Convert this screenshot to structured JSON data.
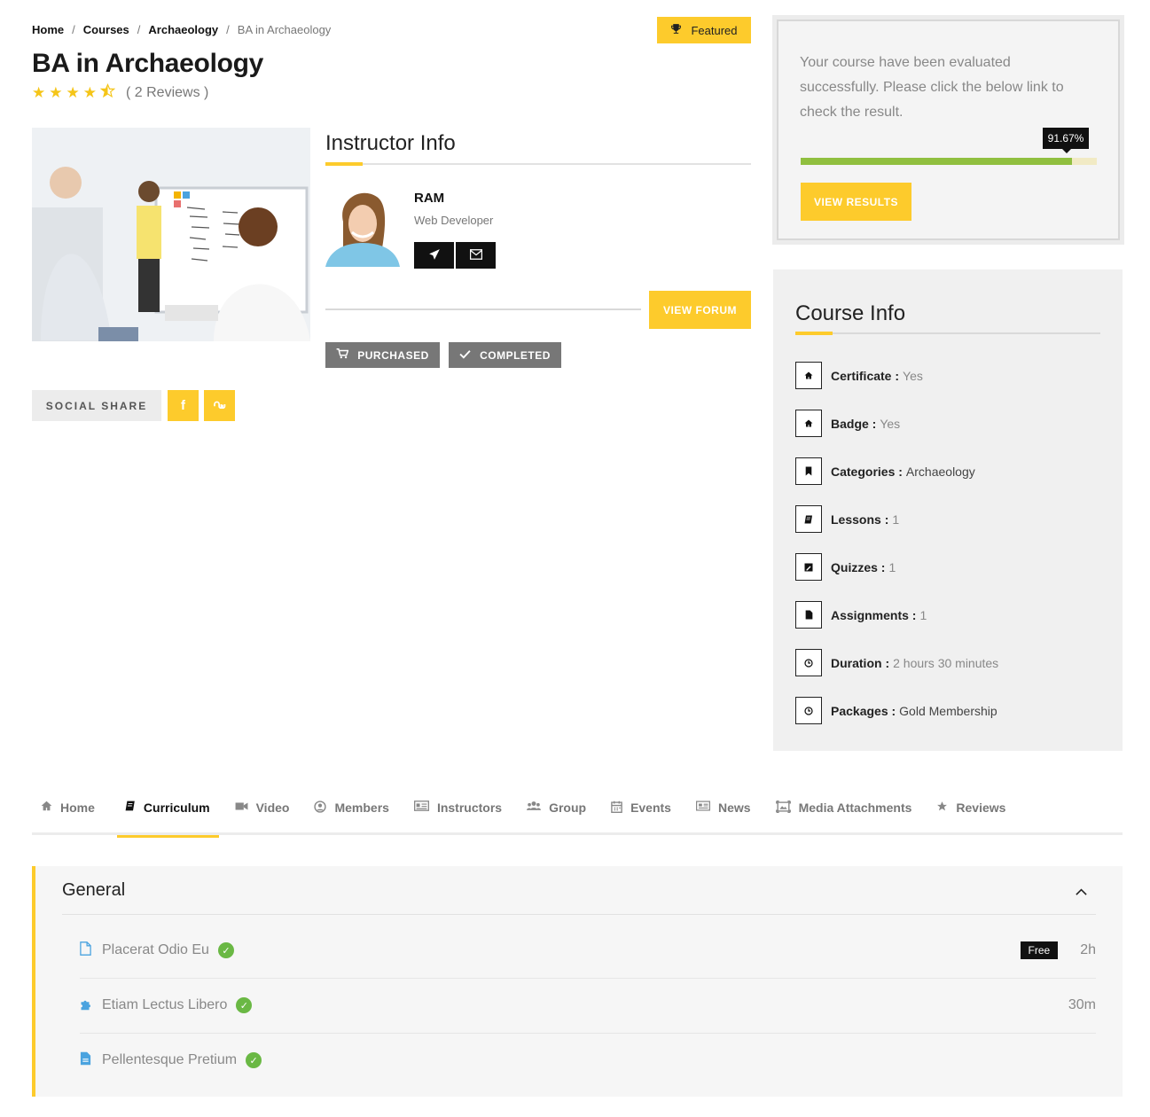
{
  "breadcrumb": {
    "items": [
      "Home",
      "Courses",
      "Archaeology"
    ],
    "current": "BA in Archaeology",
    "separator": "/"
  },
  "course": {
    "title": "BA in Archaeology",
    "rating": 4.5,
    "reviews_text": "( 2 Reviews )",
    "featured_label": "Featured"
  },
  "instructor": {
    "heading": "Instructor Info",
    "name": "RAM",
    "role": "Web Developer",
    "forum_button": "VIEW FORUM",
    "purchased_label": "PURCHASED",
    "completed_label": "COMPLETED"
  },
  "social": {
    "label": "SOCIAL SHARE",
    "facebook": "f"
  },
  "evaluation": {
    "message": "Your course have been evaluated successfully. Please click the below link to check the result.",
    "progress_text": "91.67%",
    "progress_value": 91.67,
    "button": "VIEW RESULTS"
  },
  "course_info": {
    "heading": "Course Info",
    "items": [
      {
        "label": "Certificate :",
        "value": "Yes",
        "icon": "home-icon"
      },
      {
        "label": "Badge :",
        "value": "Yes",
        "icon": "home-icon"
      },
      {
        "label": "Categories :",
        "value": "Archaeology",
        "icon": "bookmark-icon"
      },
      {
        "label": "Lessons :",
        "value": "1",
        "icon": "book-icon"
      },
      {
        "label": "Quizzes :",
        "value": "1",
        "icon": "quiz-icon"
      },
      {
        "label": "Assignments :",
        "value": "1",
        "icon": "file-icon"
      },
      {
        "label": "Duration :",
        "value": "2 hours 30 minutes",
        "icon": "clock-icon"
      },
      {
        "label": "Packages :",
        "value": "Gold Membership",
        "icon": "clock-icon"
      }
    ]
  },
  "tabs": [
    {
      "label": "Home",
      "icon": "home-icon"
    },
    {
      "label": "Curriculum",
      "icon": "book-icon"
    },
    {
      "label": "Video",
      "icon": "video-icon"
    },
    {
      "label": "Members",
      "icon": "user-icon"
    },
    {
      "label": "Instructors",
      "icon": "id-card-icon"
    },
    {
      "label": "Group",
      "icon": "users-icon"
    },
    {
      "label": "Events",
      "icon": "calendar-icon"
    },
    {
      "label": "News",
      "icon": "newspaper-icon"
    },
    {
      "label": "Media Attachments",
      "icon": "image-icon"
    },
    {
      "label": "Reviews",
      "icon": "star-icon"
    }
  ],
  "curriculum": {
    "section_title": "General",
    "lessons": [
      {
        "title": "Placerat Odio Eu",
        "badge": "Free",
        "duration": "2h",
        "icon": "document-icon"
      },
      {
        "title": "Etiam Lectus Libero",
        "badge": "",
        "duration": "30m",
        "icon": "puzzle-icon"
      },
      {
        "title": "Pellentesque Pretium",
        "badge": "",
        "duration": "",
        "icon": "file-text-icon"
      }
    ]
  },
  "colors": {
    "accent": "#fdcb2c",
    "progress": "#90bf3f",
    "check": "#6ab844",
    "lesson_icon": "#4aa3df"
  }
}
